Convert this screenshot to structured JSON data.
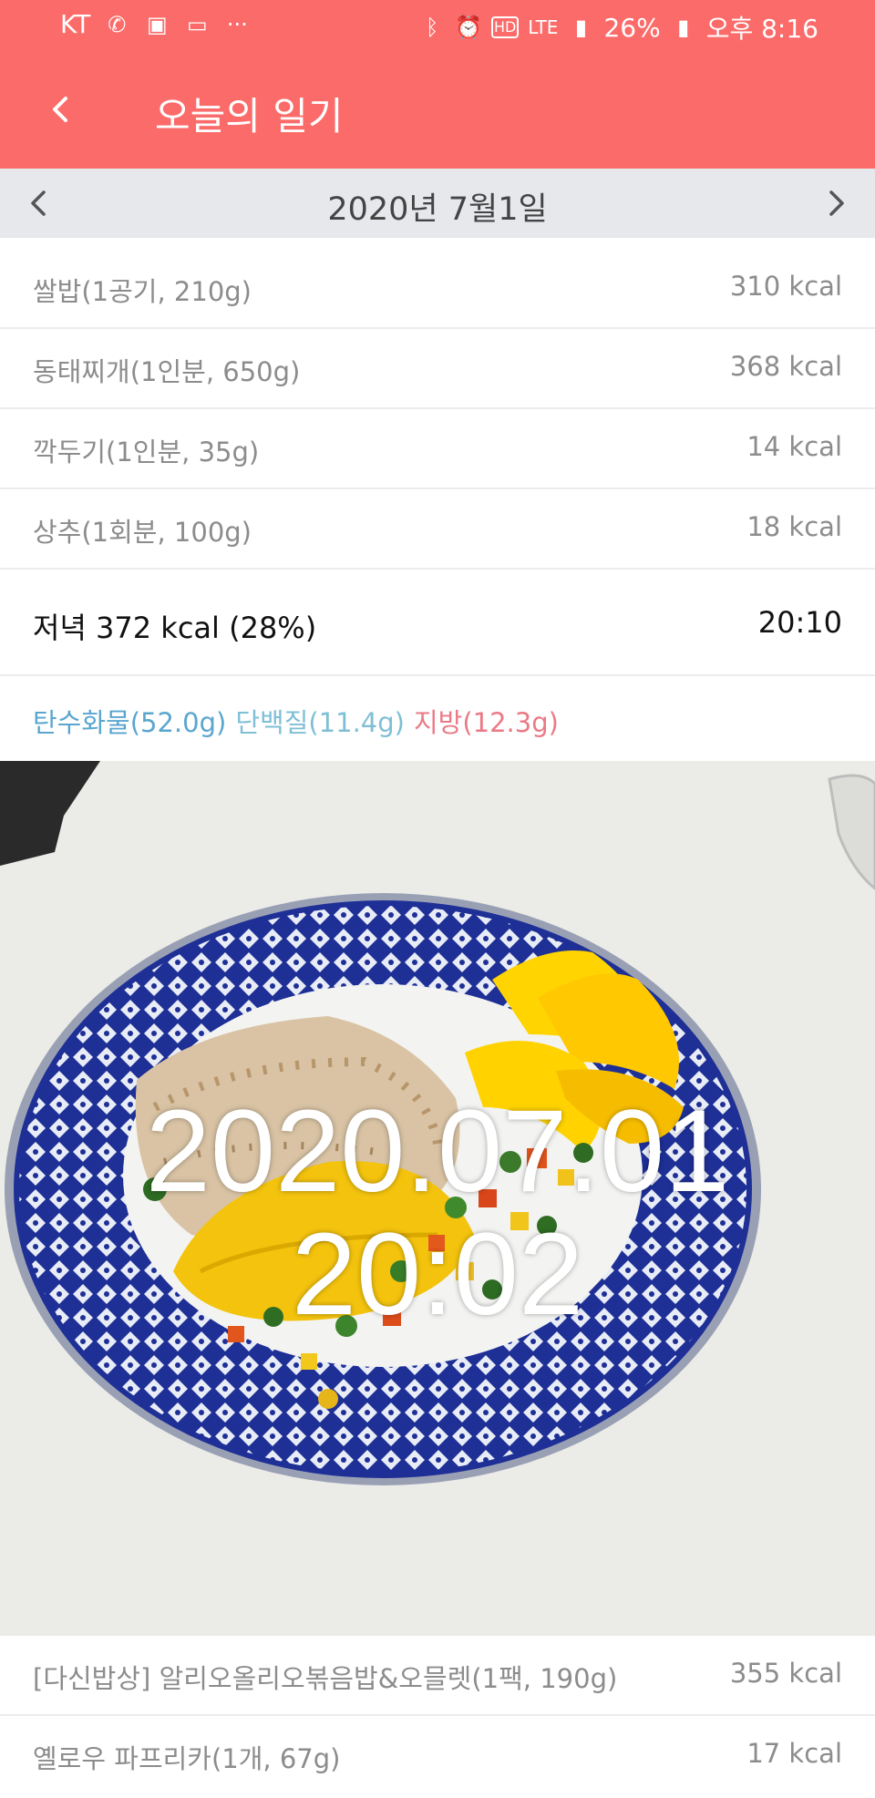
{
  "status_bar": {
    "carrier": "KT",
    "battery": "26%",
    "time": "오후 8:16",
    "left_icons": [
      "wifi-calling-icon",
      "voicemail-icon",
      "card-icon",
      "more-dots-icon"
    ],
    "right_icons": [
      "bluetooth-icon",
      "alarm-icon",
      "hd-icon",
      "lte-icon",
      "signal-icon",
      "battery-icon"
    ],
    "lte_label": "LTE",
    "hd_label": "HD"
  },
  "app_bar": {
    "title": "오늘의 일기"
  },
  "date_bar": {
    "date": "2020년 7월1일"
  },
  "food_items_top": [
    {
      "name": "쌀밥(1공기, 210g)",
      "kcal": "310 kcal"
    },
    {
      "name": "동태찌개(1인분, 650g)",
      "kcal": "368 kcal"
    },
    {
      "name": "깍두기(1인분, 35g)",
      "kcal": "14 kcal"
    },
    {
      "name": "상추(1회분, 100g)",
      "kcal": "18 kcal"
    }
  ],
  "meal": {
    "title": "저녁 372 kcal (28%)",
    "time": "20:10"
  },
  "macros": {
    "carb": "탄수화물(52.0g)",
    "protein": "단백질(11.4g)",
    "fat": "지방(12.3g)"
  },
  "photo": {
    "stamp_date": "2020.07.01",
    "stamp_time": "20:02"
  },
  "food_items_bottom": [
    {
      "name": "[다신밥상] 알리오올리오볶음밥&오믈렛(1팩, 190g)",
      "kcal": "355 kcal"
    },
    {
      "name": "옐로우 파프리카(1개, 67g)",
      "kcal": "17 kcal"
    }
  ],
  "colors": {
    "accent": "#fb6b69",
    "date_bar": "#e6e8ec",
    "carb": "#5aa6cf",
    "protein": "#7fbfd6",
    "fat": "#ea7a86"
  }
}
